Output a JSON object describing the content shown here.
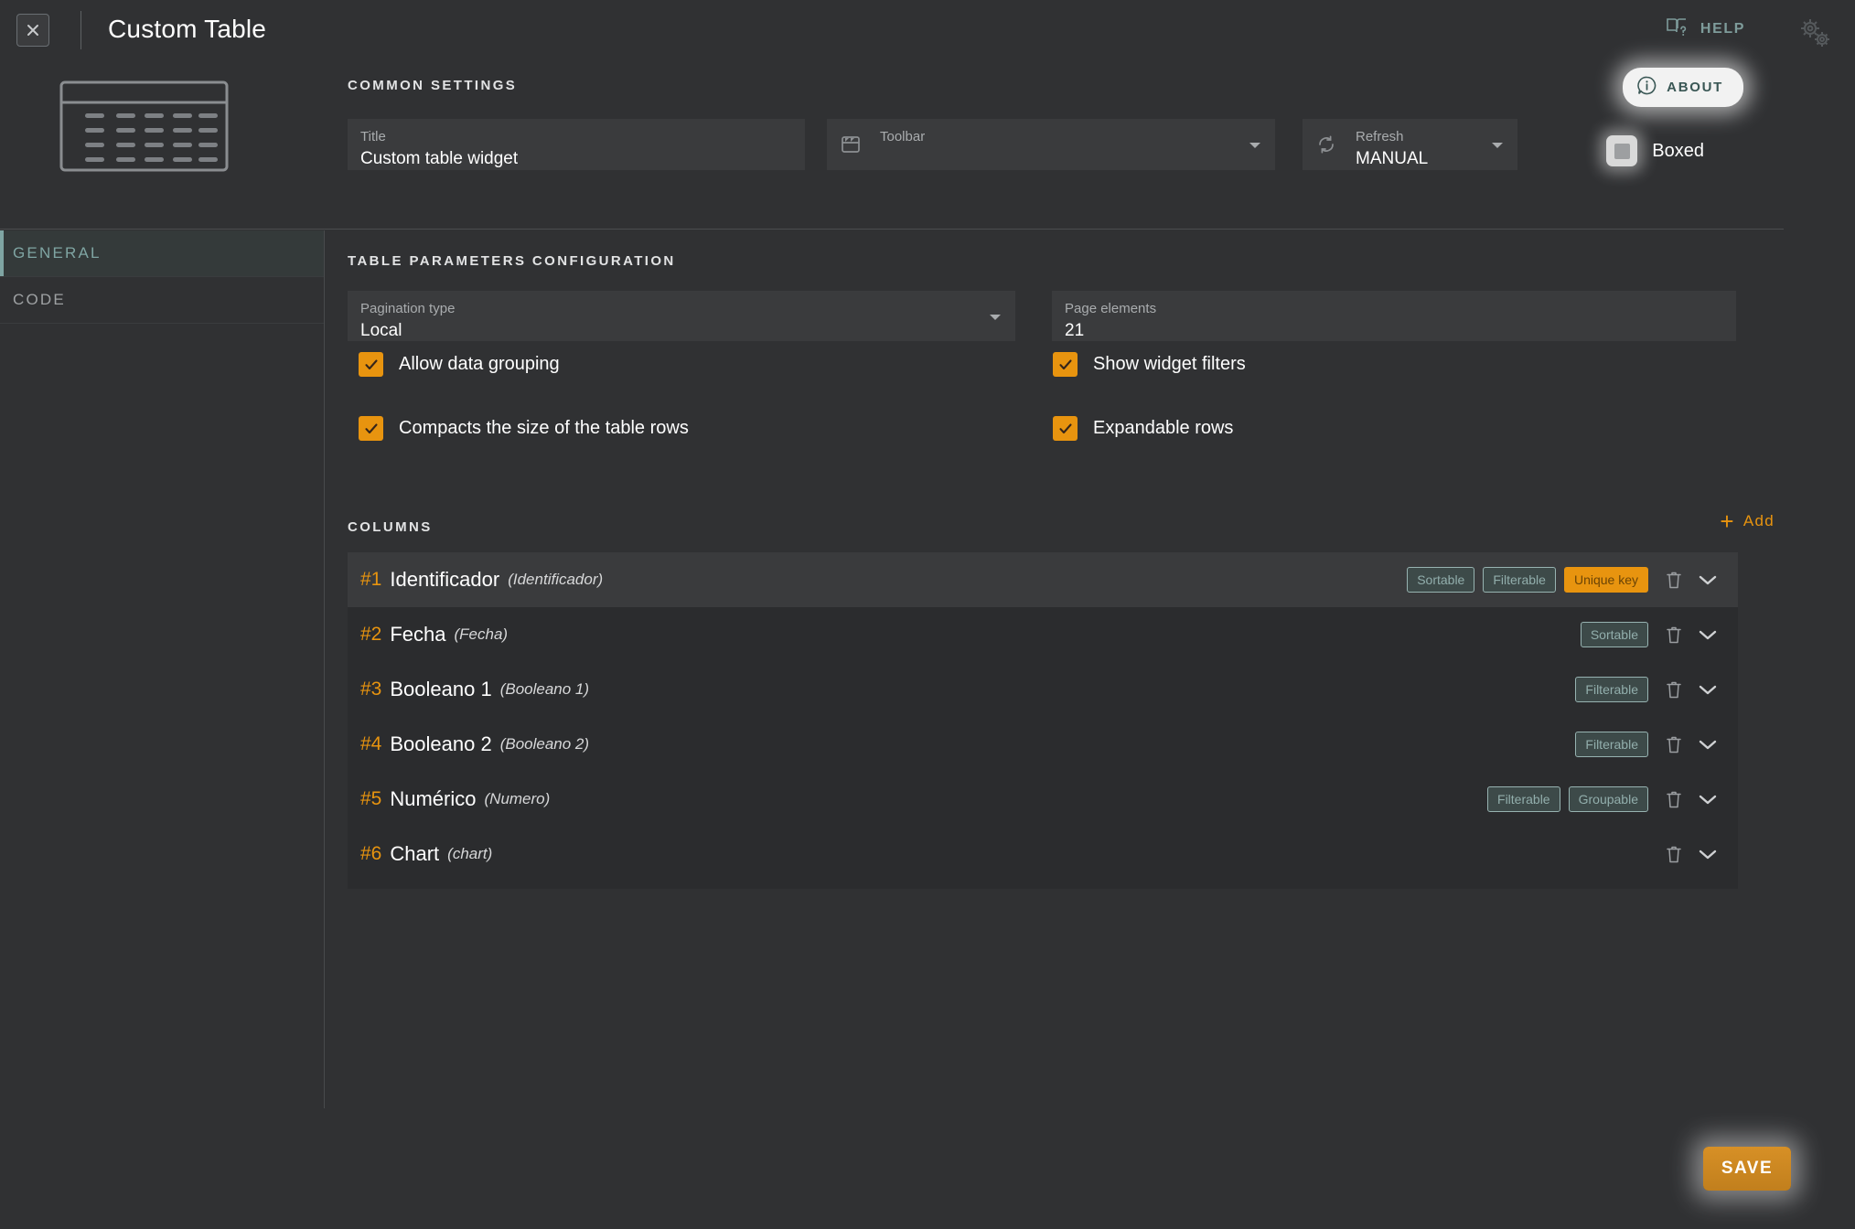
{
  "header": {
    "title": "Custom Table",
    "close_icon": "close-x-icon",
    "help_label": "HELP",
    "help_icon": "book-question-icon",
    "settings_icon": "gears-icon",
    "about_label": "ABOUT",
    "about_icon": "info-circle-icon"
  },
  "sidebar": {
    "widget_icon": "table-widget-icon",
    "items": [
      {
        "label": "GENERAL",
        "active": true
      },
      {
        "label": "CODE",
        "active": false
      }
    ]
  },
  "common_settings": {
    "section_label": "COMMON SETTINGS",
    "title_field": {
      "label": "Title",
      "value": "Custom table widget"
    },
    "toolbar_field": {
      "label": "Toolbar",
      "value": "",
      "icon": "toolbar-icon"
    },
    "refresh_field": {
      "label": "Refresh",
      "value": "MANUAL",
      "icon": "refresh-icon"
    },
    "boxed": {
      "label": "Boxed",
      "checked": false
    }
  },
  "table_parameters": {
    "section_label": "TABLE PARAMETERS CONFIGURATION",
    "pagination_field": {
      "label": "Pagination type",
      "value": "Local"
    },
    "page_elements_field": {
      "label": "Page elements",
      "value": "21"
    },
    "checkboxes": [
      {
        "label": "Allow data grouping",
        "checked": true
      },
      {
        "label": "Show widget filters",
        "checked": true
      },
      {
        "label": "Compacts the size of the table rows",
        "checked": true
      },
      {
        "label": "Expandable rows",
        "checked": true
      }
    ]
  },
  "columns": {
    "section_label": "COLUMNS",
    "add_label": "Add",
    "add_icon": "plus-icon",
    "delete_icon": "trash-icon",
    "expand_icon": "chevron-down-icon",
    "rows": [
      {
        "index": "#1",
        "name": "Identificador",
        "key": "(Identificador)",
        "highlighted": true,
        "badges": [
          {
            "label": "Sortable",
            "kind": "outline"
          },
          {
            "label": "Filterable",
            "kind": "outline"
          },
          {
            "label": "Unique key",
            "kind": "primary"
          }
        ]
      },
      {
        "index": "#2",
        "name": "Fecha",
        "key": "(Fecha)",
        "highlighted": false,
        "badges": [
          {
            "label": "Sortable",
            "kind": "outline"
          }
        ]
      },
      {
        "index": "#3",
        "name": "Booleano 1",
        "key": "(Booleano 1)",
        "highlighted": false,
        "badges": [
          {
            "label": "Filterable",
            "kind": "outline"
          }
        ]
      },
      {
        "index": "#4",
        "name": "Booleano 2",
        "key": "(Booleano 2)",
        "highlighted": false,
        "badges": [
          {
            "label": "Filterable",
            "kind": "outline"
          }
        ]
      },
      {
        "index": "#5",
        "name": "Numérico",
        "key": "(Numero)",
        "highlighted": false,
        "badges": [
          {
            "label": "Filterable",
            "kind": "outline"
          },
          {
            "label": "Groupable",
            "kind": "outline"
          }
        ]
      },
      {
        "index": "#6",
        "name": "Chart",
        "key": "(chart)",
        "highlighted": false,
        "badges": []
      }
    ]
  },
  "footer": {
    "save_label": "SAVE"
  },
  "colors": {
    "background": "#303133",
    "panel": "#2b2c2e",
    "field": "#3a3b3d",
    "accent": "#e8940f",
    "teal": "#7fa5a3",
    "text": "#ffffff"
  }
}
